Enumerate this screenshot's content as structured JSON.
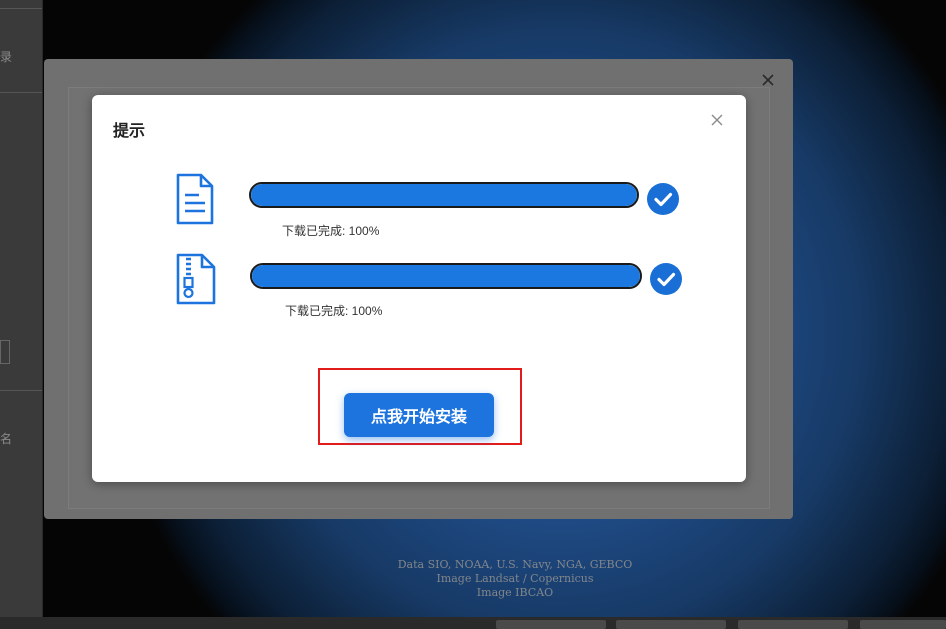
{
  "background": {
    "left_panel_fragments": [
      "录",
      "名"
    ],
    "attribution_lines": [
      "Data SIO, NOAA, U.S. Navy, NGA, GEBCO",
      "Image Landsat / Copernicus",
      "Image IBCAO"
    ]
  },
  "dialog": {
    "title": "提示",
    "rows": [
      {
        "icon": "document-icon",
        "progress": 1.0,
        "status": "下载已完成: 100%"
      },
      {
        "icon": "zip-file-icon",
        "progress": 1.0,
        "status": "下载已完成: 100%"
      }
    ],
    "install_button_label": "点我开始安装"
  },
  "colors": {
    "accent": "#1d74de",
    "progress_fill": "#1a78e0",
    "highlight": "#e21b1b"
  }
}
